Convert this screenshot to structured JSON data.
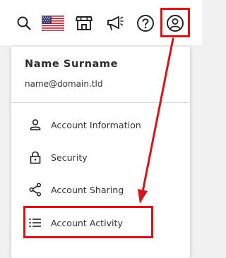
{
  "user": {
    "name": "Name Surname",
    "email": "name@domain.tld"
  },
  "menu": {
    "items": [
      {
        "label": "Account Information",
        "icon": "person-icon"
      },
      {
        "label": "Security",
        "icon": "lock-icon"
      },
      {
        "label": "Account Sharing",
        "icon": "share-icon"
      },
      {
        "label": "Account Activity",
        "icon": "list-icon"
      }
    ]
  },
  "toolbar": {
    "icons": [
      "search-icon",
      "us-flag-icon",
      "store-icon",
      "megaphone-icon",
      "help-icon",
      "account-icon"
    ]
  },
  "colors": {
    "highlight": "#d4161a",
    "icon": "#222222"
  }
}
